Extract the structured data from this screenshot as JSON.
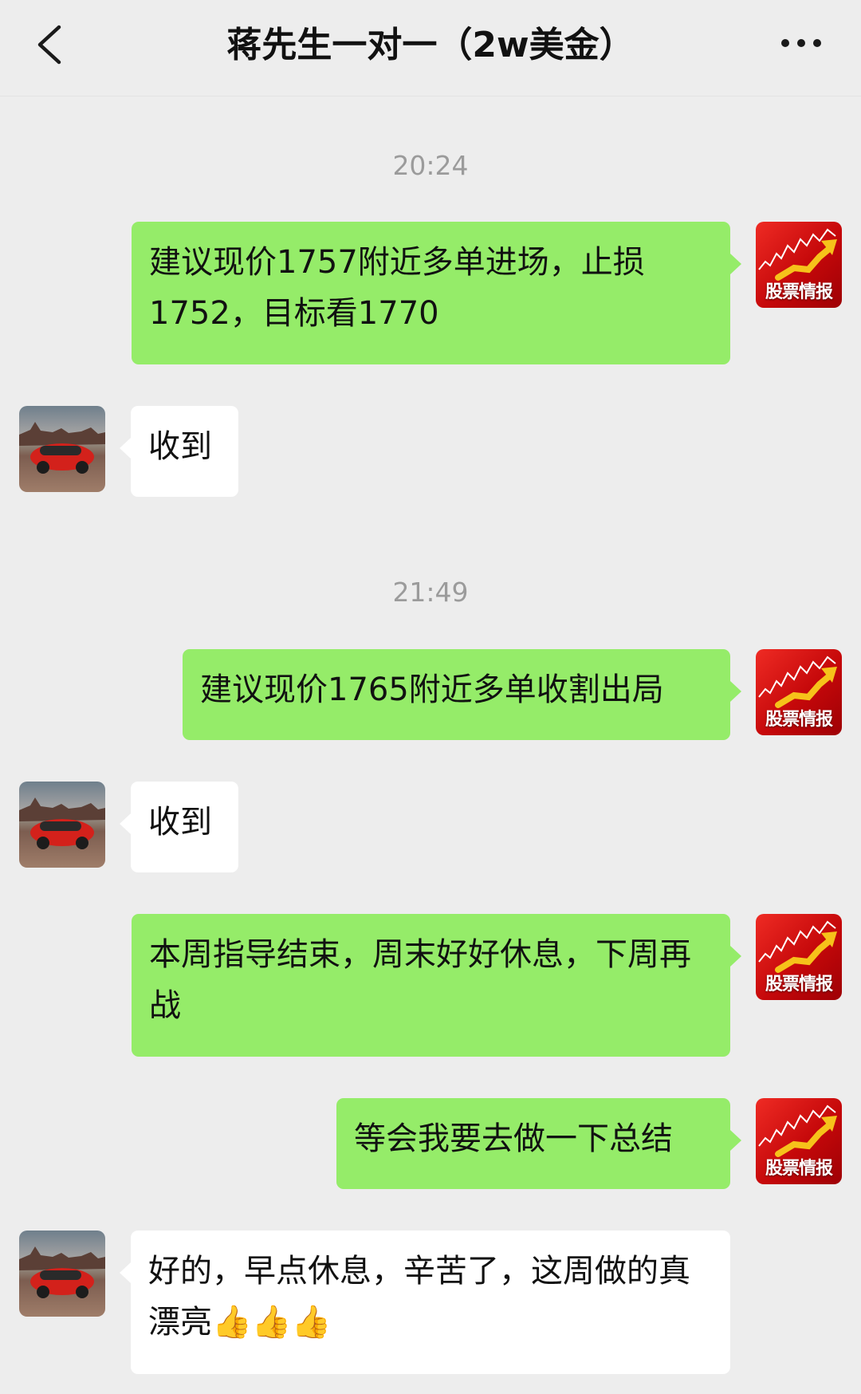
{
  "header": {
    "title": "蒋先生一对一（2w美金）",
    "back_icon": "chevron-left-icon",
    "more_icon": "more-horizontal-icon"
  },
  "theme": {
    "outgoing_bubble": "#95ec69",
    "incoming_bubble": "#ffffff",
    "chat_background": "#ededed"
  },
  "chat": {
    "timestamps": [
      "20:24",
      "21:49"
    ],
    "messages": [
      {
        "from": "me",
        "text": "建议现价1757附近多单进场，止损1752，目标看1770"
      },
      {
        "from": "contact",
        "text": "收到"
      },
      {
        "from": "me",
        "text": "建议现价1765附近多单收割出局"
      },
      {
        "from": "contact",
        "text": "收到"
      },
      {
        "from": "me",
        "text": "本周指导结束，周末好好休息，下周再战"
      },
      {
        "from": "me",
        "text": "等会我要去做一下总结"
      },
      {
        "from": "contact",
        "text": "好的，早点休息，辛苦了，这周做的真漂亮👍👍👍"
      }
    ]
  },
  "avatars": {
    "self_label": "股票情报",
    "contact_icon": "red-car-photo-avatar"
  }
}
